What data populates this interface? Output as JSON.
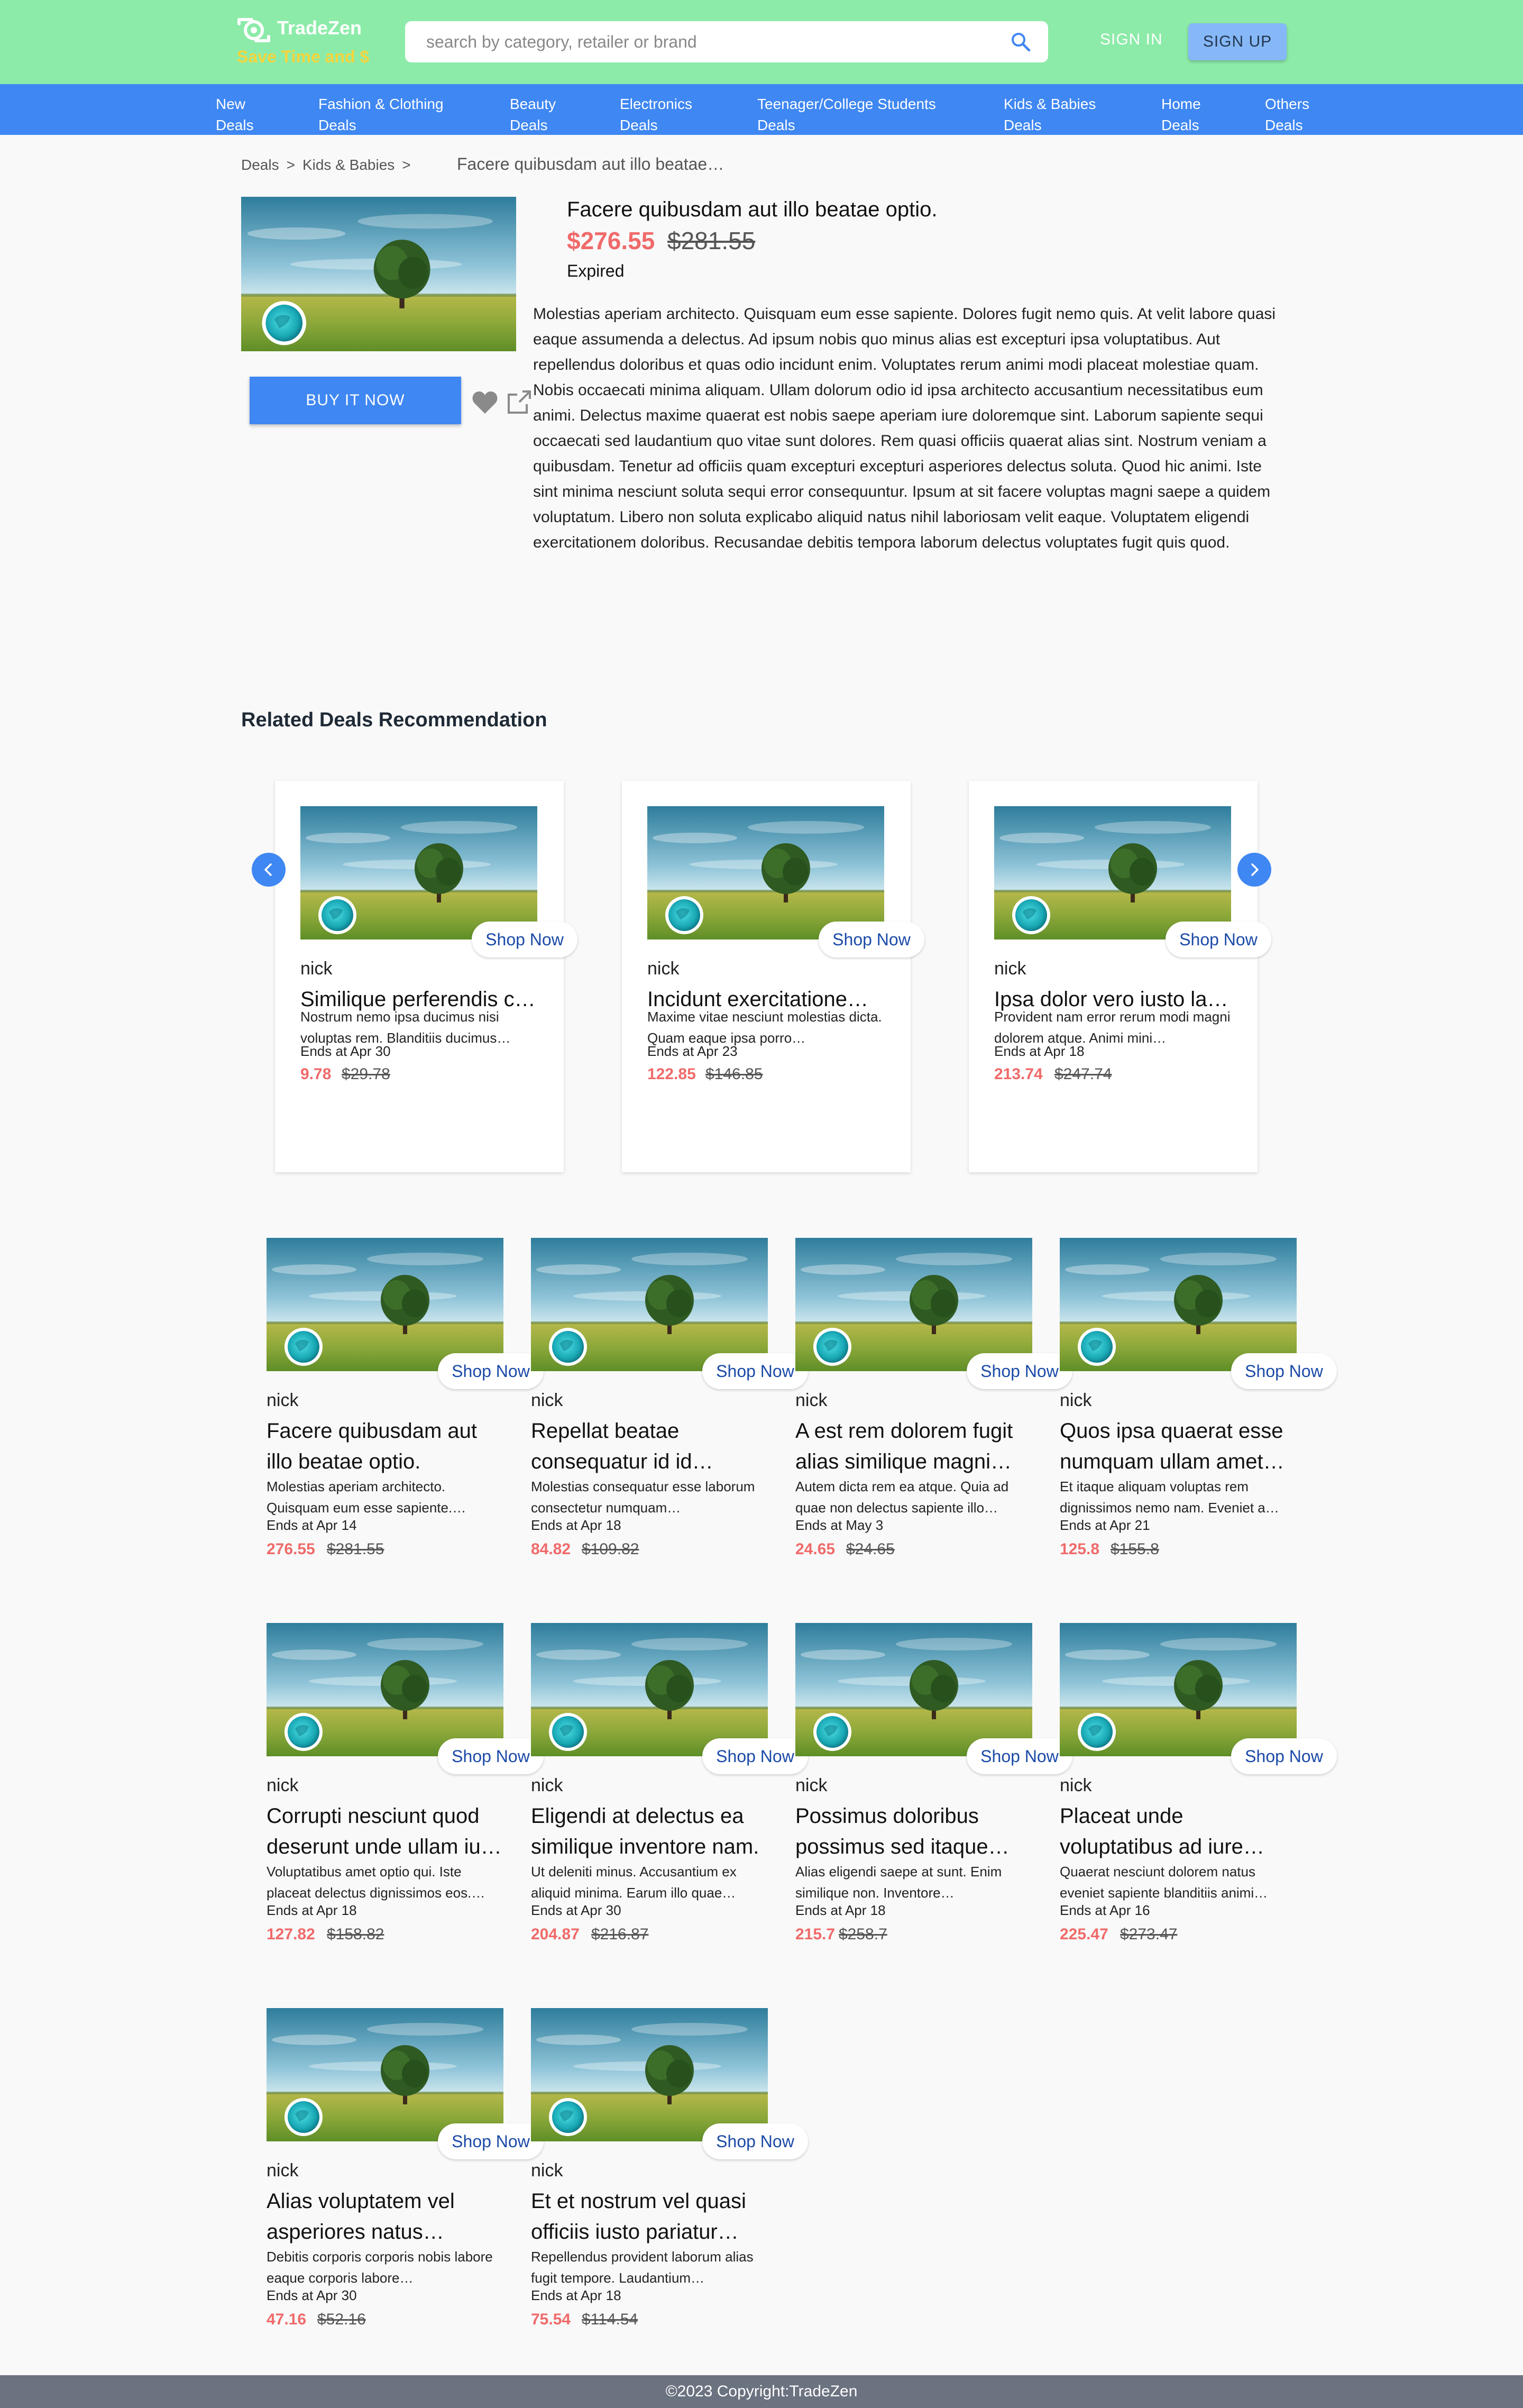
{
  "header": {
    "brand": "TradeZen",
    "tagline": "Save Time and $",
    "search_placeholder": "search by category, retailer or brand",
    "signin": "SIGN IN",
    "signup": "SIGN UP",
    "colors": {
      "topbar": "#8ceba8",
      "navbar": "#3f87f2",
      "tagline": "#f4d53f",
      "price": "#f06a6a"
    }
  },
  "nav": [
    {
      "line1": "New",
      "line2": "Deals"
    },
    {
      "line1": "Fashion & Clothing",
      "line2": "Deals"
    },
    {
      "line1": "Beauty",
      "line2": "Deals"
    },
    {
      "line1": "Electronics",
      "line2": "Deals"
    },
    {
      "line1": "Teenager/College Students",
      "line2": "Deals"
    },
    {
      "line1": "Kids & Babies",
      "line2": "Deals"
    },
    {
      "line1": "Home",
      "line2": "Deals"
    },
    {
      "line1": "Others",
      "line2": "Deals"
    }
  ],
  "breadcrumb": {
    "items": [
      "Deals",
      "Kids & Babies"
    ],
    "separator": ">",
    "current": "Facere quibusdam aut illo beatae…"
  },
  "product": {
    "title": "Facere quibusdam aut illo beatae optio.",
    "price": "$276.55",
    "old_price": "$281.55",
    "status": "Expired",
    "buy_label": "BUY IT NOW",
    "description": "Molestias aperiam architecto. Quisquam eum esse sapiente. Dolores fugit nemo quis. At velit labore quasi eaque assumenda a delectus. Ad ipsum nobis quo minus alias est excepturi ipsa voluptatibus. Aut repellendus doloribus et quas odio incidunt enim. Voluptates rerum animi modi placeat molestiae quam. Nobis occaecati minima aliquam. Ullam dolorum odio id ipsa architecto accusantium necessitatibus eum animi. Delectus maxime quaerat est nobis saepe aperiam iure doloremque sint. Laborum sapiente sequi occaecati sed laudantium quo vitae sunt dolores. Rem quasi officiis quaerat alias sint. Nostrum veniam a quibusdam. Tenetur ad officiis quam excepturi excepturi asperiores delectus soluta. Quod hic animi. Iste sint minima nesciunt soluta sequi error consequuntur. Ipsum at sit facere voluptas magni saepe a quidem voluptatum. Libero non soluta explicabo aliquid natus nihil laboriosam velit eaque. Voluptatem eligendi exercitationem doloribus. Recusandae debitis tempora laborum delectus voluptates fugit quis quod."
  },
  "related": {
    "heading": "Related Deals Recommendation",
    "shop_label": "Shop Now",
    "carousel": [
      {
        "user": "nick",
        "title": "Similique perferendis c…",
        "desc": "Nostrum nemo ipsa ducimus nisi voluptas rem. Blanditiis ducimus…",
        "ends": "Ends at Apr 30",
        "price": "9.78",
        "old": "$29.78"
      },
      {
        "user": "nick",
        "title": "Incidunt exercitatione…",
        "desc": "Maxime vitae nesciunt molestias dicta. Quam eaque ipsa porro…",
        "ends": "Ends at Apr 23",
        "price": "122.85",
        "old": "$146.85"
      },
      {
        "user": "nick",
        "title": "Ipsa dolor vero iusto la…",
        "desc": "Provident nam error rerum modi magni dolorem atque. Animi mini…",
        "ends": "Ends at Apr 18",
        "price": "213.74",
        "old": "$247.74"
      }
    ],
    "grid": [
      {
        "user": "nick",
        "title": "Facere quibusdam aut illo beatae optio.",
        "desc": "Molestias aperiam architecto. Quisquam eum esse sapiente.…",
        "ends": "Ends at Apr 14",
        "price": "276.55",
        "old": "$281.55"
      },
      {
        "user": "nick",
        "title": "Repellat beatae consequatur id id…",
        "desc": "Molestias consequatur esse laborum consectetur numquam…",
        "ends": "Ends at Apr 18",
        "price": "84.82",
        "old": "$109.82"
      },
      {
        "user": "nick",
        "title": "A est rem dolorem fugit alias similique magni…",
        "desc": "Autem dicta rem ea atque. Quia ad quae non delectus sapiente illo…",
        "ends": "Ends at May 3",
        "price": "24.65",
        "old": "$24.65"
      },
      {
        "user": "nick",
        "title": "Quos ipsa quaerat esse numquam ullam amet…",
        "desc": "Et itaque aliquam voluptas rem dignissimos nemo nam. Eveniet a…",
        "ends": "Ends at Apr 21",
        "price": "125.8",
        "old": "$155.8"
      },
      {
        "user": "nick",
        "title": "Corrupti nesciunt quod deserunt unde ullam iu…",
        "desc": "Voluptatibus amet optio qui. Iste placeat delectus dignissimos eos.…",
        "ends": "Ends at Apr 18",
        "price": "127.82",
        "old": "$158.82"
      },
      {
        "user": "nick",
        "title": "Eligendi at delectus ea similique inventore nam.",
        "desc": "Ut deleniti minus. Accusantium ex aliquid minima. Earum illo quae…",
        "ends": "Ends at Apr 30",
        "price": "204.87",
        "old": "$216.87"
      },
      {
        "user": "nick",
        "title": "Possimus doloribus possimus sed itaque…",
        "desc": "Alias eligendi saepe at sunt. Enim similique non. Inventore…",
        "ends": "Ends at Apr 18",
        "price": "215.7",
        "old": "$258.7"
      },
      {
        "user": "nick",
        "title": "Placeat unde voluptatibus ad iure…",
        "desc": "Quaerat nesciunt dolorem natus eveniet sapiente blanditiis animi…",
        "ends": "Ends at Apr 16",
        "price": "225.47",
        "old": "$273.47"
      },
      {
        "user": "nick",
        "title": "Alias voluptatem vel asperiores natus…",
        "desc": "Debitis corporis corporis nobis labore eaque corporis labore…",
        "ends": "Ends at Apr 30",
        "price": "47.16",
        "old": "$52.16"
      },
      {
        "user": "nick",
        "title": "Et et nostrum vel quasi officiis iusto pariatur…",
        "desc": "Repellendus provident laborum alias fugit tempore. Laudantium…",
        "ends": "Ends at Apr 18",
        "price": "75.54",
        "old": "$114.54"
      }
    ]
  },
  "footer": {
    "copyright": "©2023 Copyright:TradeZen"
  }
}
